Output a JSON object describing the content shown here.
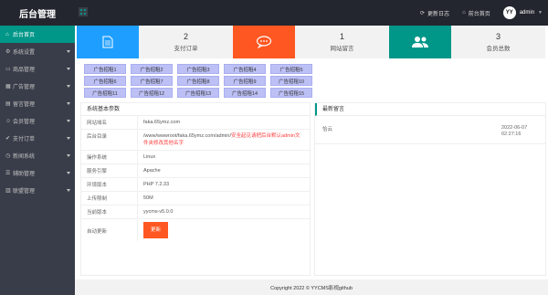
{
  "header": {
    "logo": "后台管理",
    "links": [
      {
        "icon": "refresh-icon",
        "label": "更新日志"
      },
      {
        "icon": "home-icon",
        "label": "前台首页"
      }
    ],
    "user": {
      "avatar_text": "YY",
      "name": "admin"
    }
  },
  "sidebar": {
    "items": [
      {
        "label": "后台首页",
        "active": true,
        "has_arrow": false
      },
      {
        "label": "系统设置",
        "active": false,
        "has_arrow": true
      },
      {
        "label": "商品管理",
        "active": false,
        "has_arrow": true
      },
      {
        "label": "广告管理",
        "active": false,
        "has_arrow": true
      },
      {
        "label": "留言管理",
        "active": false,
        "has_arrow": true
      },
      {
        "label": "会员管理",
        "active": false,
        "has_arrow": true
      },
      {
        "label": "支付订单",
        "active": false,
        "has_arrow": true
      },
      {
        "label": "新闻系统",
        "active": false,
        "has_arrow": true
      },
      {
        "label": "辅助管理",
        "active": false,
        "has_arrow": true
      },
      {
        "label": "联盟管理",
        "active": false,
        "has_arrow": true
      }
    ]
  },
  "stats": [
    {
      "value": "2",
      "label": "支付订单",
      "icon": "document-icon",
      "color": "#1e9fff"
    },
    {
      "value": "1",
      "label": "网站留言",
      "icon": "chat-icon",
      "color": "#ff5722"
    },
    {
      "value": "3",
      "label": "会员总数",
      "icon": "users-icon",
      "color": "#009688"
    }
  ],
  "ads": [
    "广告招租1",
    "广告招租2",
    "广告招租3",
    "广告招租4",
    "广告招租5",
    "广告招租6",
    "广告招租7",
    "广告招租8",
    "广告招租9",
    "广告招租10",
    "广告招租11",
    "广告招租12",
    "广告招租13",
    "广告招租14",
    "广告招租15"
  ],
  "system_panel": {
    "title": "系统基本参数",
    "rows": [
      {
        "key": "网站域名",
        "value": "faka.65ymz.com"
      },
      {
        "key": "后台目录",
        "value": "/www/wwwroot/faka.65ymz.com/admin/",
        "warning": "安全起见请把后台默认admin文件夹修改其他名字"
      },
      {
        "key": "操作系统",
        "value": "Linux"
      },
      {
        "key": "服务引擎",
        "value": "Apache"
      },
      {
        "key": "环境版本",
        "value": "PHP 7.2.33"
      },
      {
        "key": "上传限制",
        "value": "50M"
      },
      {
        "key": "当前版本",
        "value": "yycms-v5.0.0"
      }
    ],
    "update": {
      "key": "自动更新",
      "button": "更新"
    }
  },
  "messages_panel": {
    "title": "最新留言",
    "items": [
      {
        "name": "恰云",
        "date": "2022-06-07",
        "time": "02:27:16"
      }
    ]
  },
  "footer": {
    "text": "Copyright 2022 © YYCMS影视github"
  }
}
